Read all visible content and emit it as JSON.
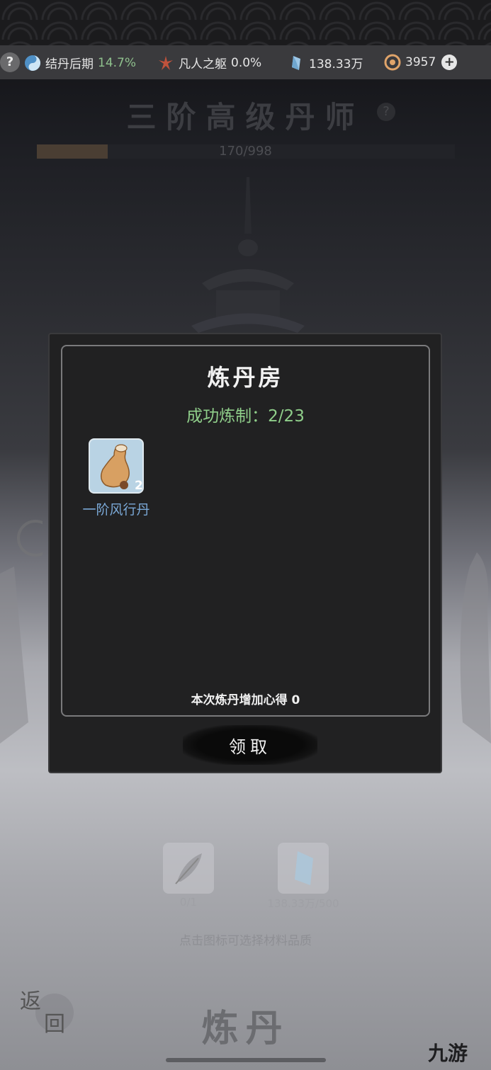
{
  "topbar": {
    "help": "?",
    "realm_label": "结丹后期",
    "realm_percent": "14.7%",
    "body_label": "凡人之躯",
    "body_percent": "0.0%",
    "spirit_stones": "138.33万",
    "currency": "3957",
    "add": "+"
  },
  "rank": {
    "title": "三阶高级丹师",
    "help": "?",
    "progress_text": "170/998",
    "progress_fraction": 0.17
  },
  "modal": {
    "title": "炼丹房",
    "success_text": "成功炼制：2/23",
    "items": [
      {
        "name": "一阶风行丹",
        "count": "2",
        "icon": "gourd-pill-icon"
      }
    ],
    "gain_text": "本次炼丹增加心得 0",
    "claim_label": "领取"
  },
  "materials": [
    {
      "icon": "herb-leaf-icon",
      "label": "0/1"
    },
    {
      "icon": "spirit-stone-icon",
      "label": "138.33万/500"
    }
  ],
  "hint": "点击图标可选择材料品质",
  "back_label_1": "返",
  "back_label_2": "回",
  "footer_title": "炼丹",
  "watermark": "九游",
  "colors": {
    "success": "#8fce8a",
    "item_name": "#7aa8d6",
    "realm_percent": "#8fc08d"
  }
}
